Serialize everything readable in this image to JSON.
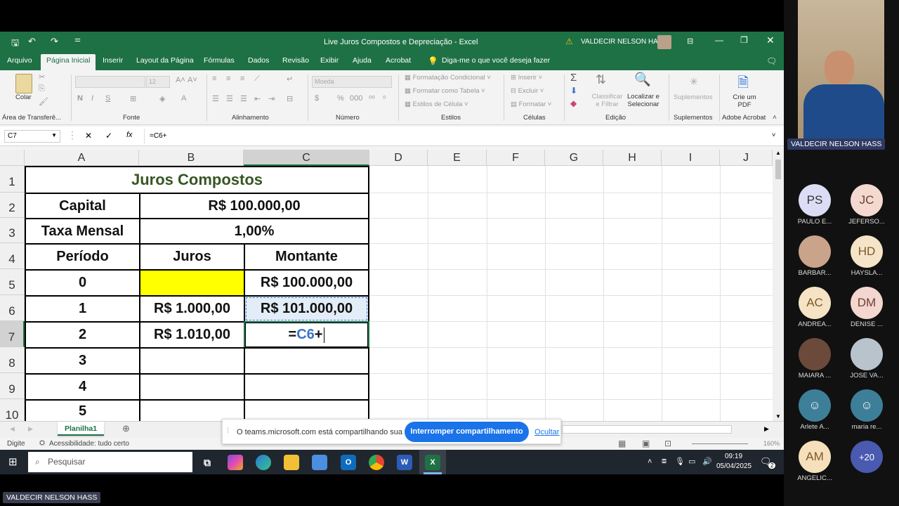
{
  "excel": {
    "title": "Live Juros Compostos e Depreciação  -  Excel",
    "user": "VALDECIR NELSON HASS",
    "ribbon_tabs": [
      "Arquivo",
      "Página Inicial",
      "Inserir",
      "Layout da Página",
      "Fórmulas",
      "Dados",
      "Revisão",
      "Exibir",
      "Ajuda",
      "Acrobat"
    ],
    "tell_me": "Diga-me o que você deseja fazer",
    "groups": {
      "clipboard": "Área de Transferê...",
      "paste": "Colar",
      "font": "Fonte",
      "font_size": "12",
      "alignment": "Alinhamento",
      "number": "Número",
      "number_format": "Moeda",
      "styles": "Estilos",
      "cond_format": "Formatação Condicional",
      "format_table": "Formatar como Tabela",
      "cell_styles": "Estilos de Célula",
      "cells": "Células",
      "insert": "Inserir",
      "delete": "Excluir",
      "format": "Formatar",
      "editing": "Edição",
      "sort_filter": "Classificar e Filtrar",
      "find_select": "Localizar e Selecionar",
      "addins": "Suplementos",
      "addins_btn": "Suplementos",
      "create_pdf": "Crie um PDF",
      "adobe": "Adobe Acrobat"
    },
    "name_box": "C7",
    "formula": "=C6+",
    "columns": [
      "A",
      "B",
      "C",
      "D",
      "E",
      "F",
      "G",
      "H",
      "I",
      "J"
    ],
    "rows": [
      "1",
      "2",
      "3",
      "4",
      "5",
      "6",
      "7",
      "8",
      "9",
      "10"
    ],
    "sheet": {
      "title": "Juros Compostos",
      "capital_label": "Capital",
      "capital_value": "R$ 100.000,00",
      "rate_label": "Taxa Mensal",
      "rate_value": "1,00%",
      "h_period": "Período",
      "h_interest": "Juros",
      "h_amount": "Montante",
      "periods": [
        "0",
        "1",
        "2",
        "3",
        "4",
        "5"
      ],
      "interest": [
        "",
        "R$ 1.000,00",
        "R$ 1.010,00"
      ],
      "amount": [
        "R$ 100.000,00",
        "R$ 101.000,00"
      ],
      "editing_prefix": "=",
      "editing_ref": "C6",
      "editing_suffix": "+"
    },
    "sheet_tab": "Planilha1",
    "status_mode": "Digite",
    "accessibility": "Acessibilidade: tudo certo",
    "zoom": "160%",
    "share_text": "O teams.microsoft.com está compartilhando sua tela.",
    "share_stop": "Interromper compartilhamento",
    "share_hide": "Ocultar"
  },
  "taskbar": {
    "search": "Pesquisar",
    "time": "09:19",
    "date": "05/04/2025",
    "notif": "2"
  },
  "teams": {
    "presenter": "VALDECIR NELSON HASS",
    "bottom_tag": "VALDECIR NELSON HASS",
    "participants": [
      {
        "initials": "PS",
        "name": "PAULO E...",
        "bg": "#dcdcf5"
      },
      {
        "initials": "JC",
        "name": "JEFERSO...",
        "bg": "#f3d9d0"
      },
      {
        "initials": "",
        "name": "BARBAR...",
        "bg": "#c9a38a"
      },
      {
        "initials": "HD",
        "name": "HAYSLA...",
        "bg": "#f5e4c8"
      },
      {
        "initials": "AC",
        "name": "ANDREA...",
        "bg": "#f6e2c4"
      },
      {
        "initials": "DM",
        "name": "DENISE ...",
        "bg": "#f3d6cf"
      },
      {
        "initials": "",
        "name": "MAIARA ...",
        "bg": "#6b4a3c"
      },
      {
        "initials": "",
        "name": "JOSE VA...",
        "bg": "#b9c3cc"
      },
      {
        "initials": "",
        "name": "Arlete A...",
        "bg": "#3d7f99"
      },
      {
        "initials": "",
        "name": "maria re...",
        "bg": "#3d7f99"
      },
      {
        "initials": "AM",
        "name": "ANGELIC...",
        "bg": "#f5e0bb"
      },
      {
        "initials": "+20",
        "name": "",
        "bg": "#4a5ab0"
      }
    ]
  }
}
